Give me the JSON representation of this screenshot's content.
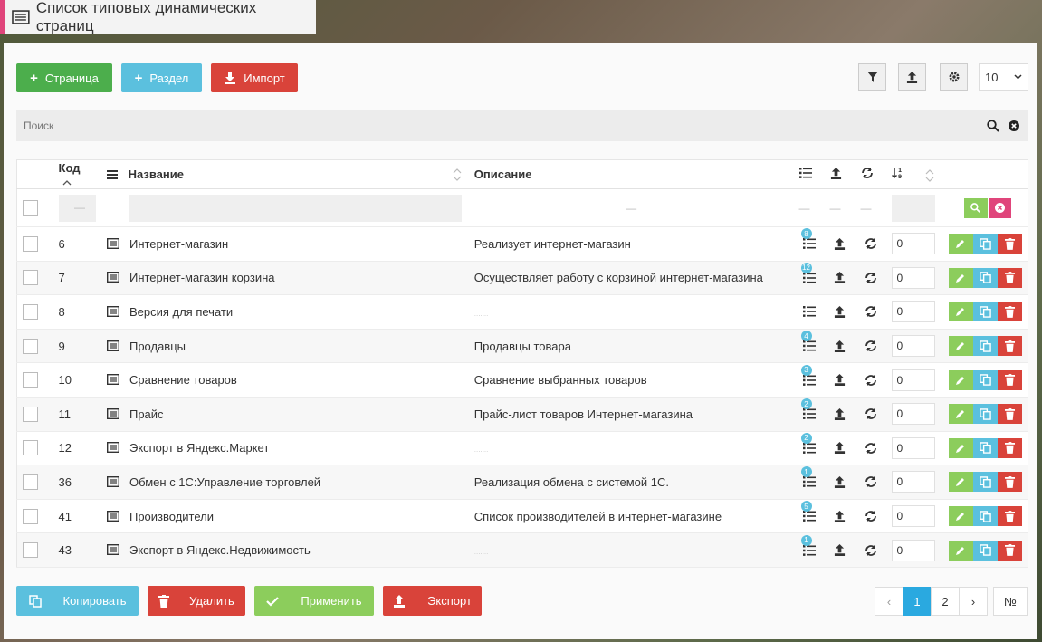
{
  "title": "Список типовых динамических страниц",
  "toolbar": {
    "add_page": "Страница",
    "add_section": "Раздел",
    "import": "Импорт",
    "per_page": "10"
  },
  "search": {
    "placeholder": "Поиск"
  },
  "columns": {
    "code": "Код",
    "name": "Название",
    "description": "Описание"
  },
  "filter_row": {
    "dash": "—"
  },
  "rows": [
    {
      "code": "6",
      "name": "Интернет-магазин",
      "description": "Реализует интернет-магазин",
      "badge": "8",
      "sort": "0"
    },
    {
      "code": "7",
      "name": "Интернет-магазин корзина",
      "description": "Осуществляет работу с корзиной интернет-магазина",
      "badge": "12",
      "sort": "0"
    },
    {
      "code": "8",
      "name": "Версия для печати",
      "description": "",
      "badge": "",
      "sort": "0"
    },
    {
      "code": "9",
      "name": "Продавцы",
      "description": "Продавцы товара",
      "badge": "4",
      "sort": "0"
    },
    {
      "code": "10",
      "name": "Сравнение товаров",
      "description": "Сравнение выбранных товаров",
      "badge": "3",
      "sort": "0"
    },
    {
      "code": "11",
      "name": "Прайс",
      "description": "Прайс-лист товаров Интернет-магазина",
      "badge": "2",
      "sort": "0"
    },
    {
      "code": "12",
      "name": "Экспорт в Яндекс.Маркет",
      "description": "",
      "badge": "2",
      "sort": "0"
    },
    {
      "code": "36",
      "name": "Обмен с 1С:Управление торговлей",
      "description": "Реализация обмена с системой 1С.",
      "badge": "1",
      "sort": "0"
    },
    {
      "code": "41",
      "name": "Производители",
      "description": "Список производителей в интернет-магазине",
      "badge": "5",
      "sort": "0"
    },
    {
      "code": "43",
      "name": "Экспорт в Яндекс.Недвижимость",
      "description": "",
      "badge": "1",
      "sort": "0"
    }
  ],
  "bottom": {
    "copy": "Копировать",
    "delete": "Удалить",
    "apply": "Применить",
    "export": "Экспорт"
  },
  "pagination": {
    "prev": "‹",
    "pages": [
      "1",
      "2"
    ],
    "next": "›",
    "goto": "№"
  },
  "colors": {
    "accent": "#2aa9e0",
    "green": "#4cae4c",
    "blue": "#5bc0de",
    "red": "#d9433a"
  }
}
